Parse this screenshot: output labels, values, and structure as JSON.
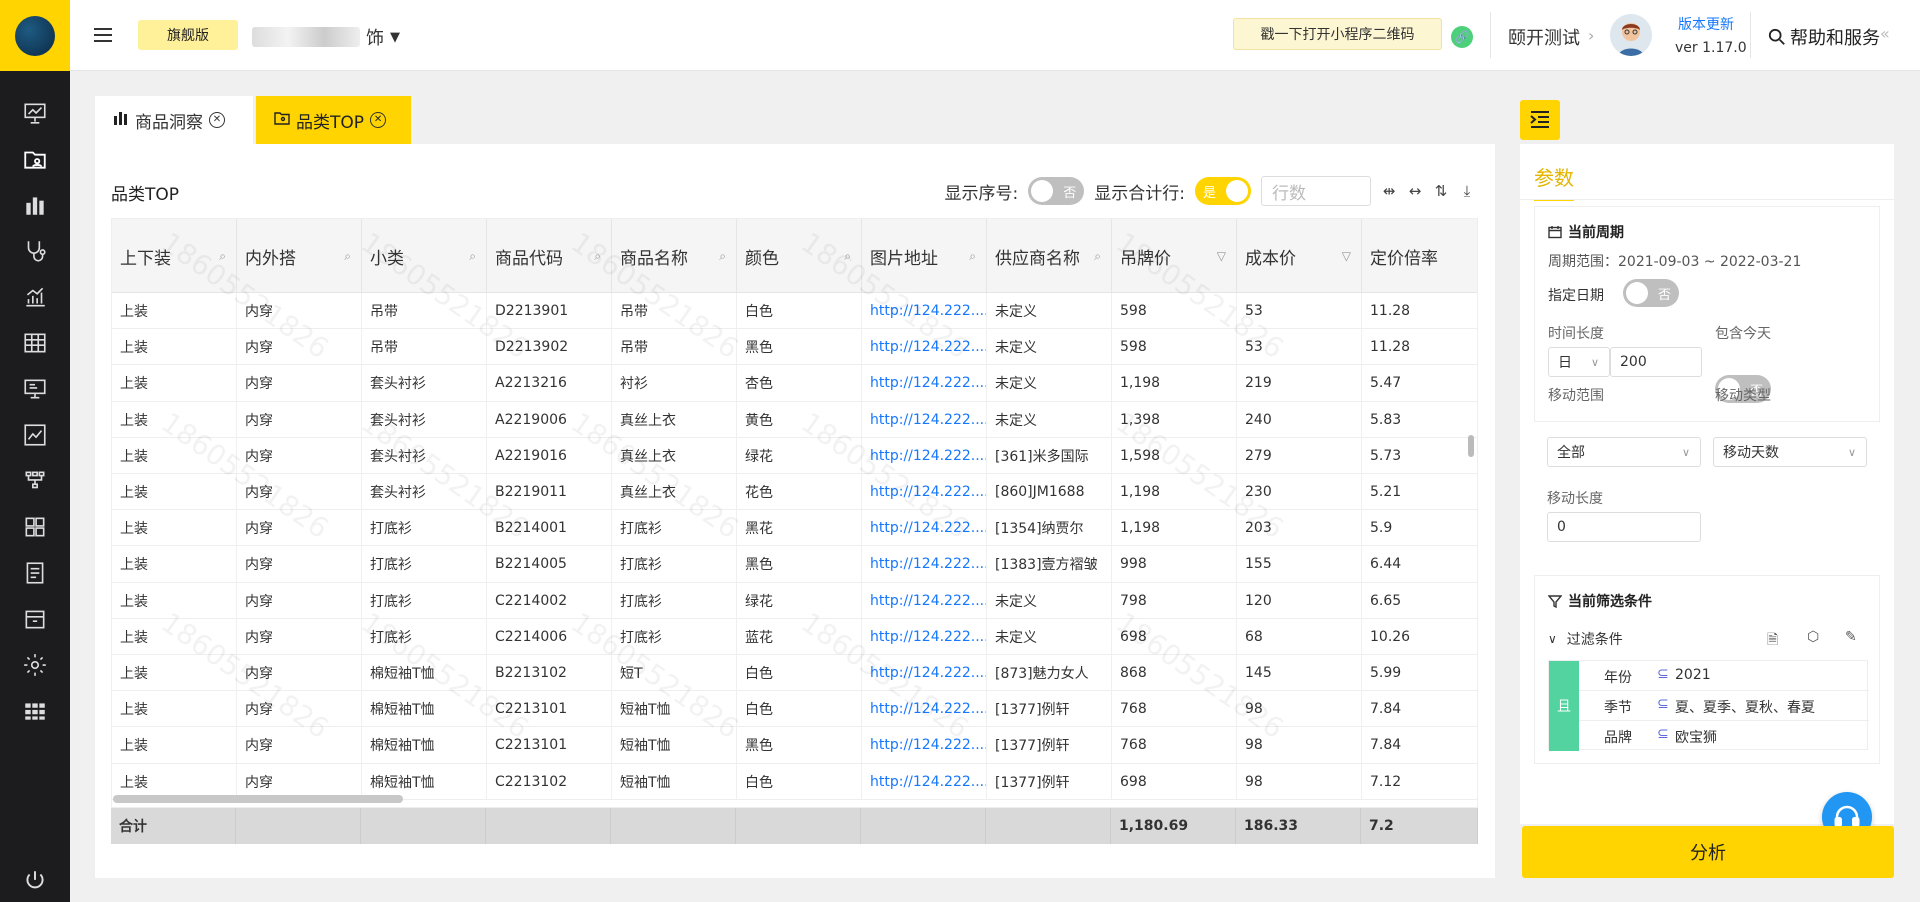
{
  "topbar": {
    "edition": "旗舰版",
    "shop_suffix": "饰",
    "qr_label": "戳一下打开小程序二维码",
    "env_name": "颐开测试",
    "version_link": "版本更新",
    "version_num": "ver 1.17.0",
    "help_label": "帮助和服务"
  },
  "tabs": [
    {
      "label": "商品洞察"
    },
    {
      "label": "品类TOP"
    }
  ],
  "table": {
    "title": "品类TOP",
    "show_index_label": "显示序号:",
    "show_index_state": "否",
    "show_total_label": "显示合计行:",
    "show_total_state": "是",
    "rows_placeholder": "行数",
    "columns": [
      "上下装",
      "内外搭",
      "小类",
      "商品代码",
      "商品名称",
      "颜色",
      "图片地址",
      "供应商名称",
      "吊牌价",
      "成本价",
      "定价倍率"
    ],
    "rows": [
      [
        "上装",
        "内穿",
        "吊带",
        "D2213901",
        "吊带",
        "白色",
        "http://124.222....",
        "未定义",
        "598",
        "53",
        "11.28"
      ],
      [
        "上装",
        "内穿",
        "吊带",
        "D2213902",
        "吊带",
        "黑色",
        "http://124.222....",
        "未定义",
        "598",
        "53",
        "11.28"
      ],
      [
        "上装",
        "内穿",
        "套头衬衫",
        "A2213216",
        "衬衫",
        "杏色",
        "http://124.222....",
        "未定义",
        "1,198",
        "219",
        "5.47"
      ],
      [
        "上装",
        "内穿",
        "套头衬衫",
        "A2219006",
        "真丝上衣",
        "黄色",
        "http://124.222....",
        "未定义",
        "1,398",
        "240",
        "5.83"
      ],
      [
        "上装",
        "内穿",
        "套头衬衫",
        "A2219016",
        "真丝上衣",
        "绿花",
        "http://124.222....",
        "[361]米多国际",
        "1,598",
        "279",
        "5.73"
      ],
      [
        "上装",
        "内穿",
        "套头衬衫",
        "B2219011",
        "真丝上衣",
        "花色",
        "http://124.222....",
        "[860]JM1688",
        "1,198",
        "230",
        "5.21"
      ],
      [
        "上装",
        "内穿",
        "打底衫",
        "B2214001",
        "打底衫",
        "黑花",
        "http://124.222....",
        "[1354]纳贾尔",
        "1,198",
        "203",
        "5.9"
      ],
      [
        "上装",
        "内穿",
        "打底衫",
        "B2214005",
        "打底衫",
        "黑色",
        "http://124.222....",
        "[1383]壹方褶皱",
        "998",
        "155",
        "6.44"
      ],
      [
        "上装",
        "内穿",
        "打底衫",
        "C2214002",
        "打底衫",
        "绿花",
        "http://124.222....",
        "未定义",
        "798",
        "120",
        "6.65"
      ],
      [
        "上装",
        "内穿",
        "打底衫",
        "C2214006",
        "打底衫",
        "蓝花",
        "http://124.222....",
        "未定义",
        "698",
        "68",
        "10.26"
      ],
      [
        "上装",
        "内穿",
        "棉短袖T恤",
        "B2213102",
        "短T",
        "白色",
        "http://124.222....",
        "[873]魅力女人",
        "868",
        "145",
        "5.99"
      ],
      [
        "上装",
        "内穿",
        "棉短袖T恤",
        "C2213101",
        "短袖T恤",
        "白色",
        "http://124.222....",
        "[1377]例轩",
        "768",
        "98",
        "7.84"
      ],
      [
        "上装",
        "内穿",
        "棉短袖T恤",
        "C2213101",
        "短袖T恤",
        "黑色",
        "http://124.222....",
        "[1377]例轩",
        "768",
        "98",
        "7.84"
      ],
      [
        "上装",
        "内穿",
        "棉短袖T恤",
        "C2213102",
        "短袖T恤",
        "白色",
        "http://124.222....",
        "[1377]例轩",
        "698",
        "98",
        "7.12"
      ]
    ],
    "total_label": "合计",
    "total_tag_price": "1,180.69",
    "total_cost": "186.33",
    "total_ratio": "7.2",
    "watermark": "18605521826"
  },
  "params": {
    "title": "参数",
    "period_title": "当前周期",
    "period_range": "周期范围：2021-09-03 ~ 2022-03-21",
    "fixed_date_label": "指定日期",
    "fixed_date_state": "否",
    "time_length_label": "时间长度",
    "include_today_label": "包含今天",
    "include_today_state": "否",
    "time_unit": "日",
    "time_value": "200",
    "move_range_label": "移动范围",
    "move_type_label": "移动类型",
    "move_range_value": "全部",
    "move_type_value": "移动天数",
    "move_length_label": "移动长度",
    "move_length_value": "0",
    "filter_title": "当前筛选条件",
    "filter_group": "过滤条件",
    "and_label": "且",
    "conditions": [
      {
        "key": "年份",
        "op": "⊆",
        "value": "2021"
      },
      {
        "key": "季节",
        "op": "⊆",
        "value": "夏、夏季、夏秋、春夏"
      },
      {
        "key": "品牌",
        "op": "⊆",
        "value": "欧宝狮"
      }
    ],
    "analyze_label": "分析"
  },
  "colors": {
    "accent": "#ffd400",
    "sidebar": "#1c1c1e",
    "link": "#1677ff",
    "and_bar": "#52d3a0"
  }
}
